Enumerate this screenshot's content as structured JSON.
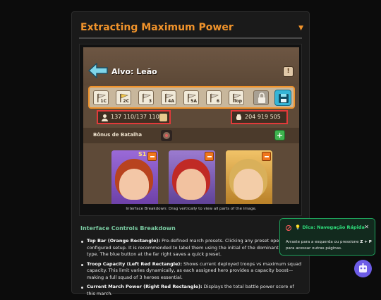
{
  "section": {
    "title": "Extracting Maximum Power",
    "toggle_icon": "chevron-down-icon"
  },
  "game": {
    "title": "Alvo: Leão",
    "presets": [
      {
        "label": "1C",
        "color": "#d7d0c4"
      },
      {
        "label": "2C",
        "color": "#f2c84b"
      },
      {
        "label": "3",
        "color": "#d7d0c4"
      },
      {
        "label": "4A",
        "color": "#d7d0c4"
      },
      {
        "label": "5A",
        "color": "#d7d0c4"
      },
      {
        "label": "6",
        "color": "#d7d0c4"
      },
      {
        "label": "Top",
        "color": "#d7d0c4"
      }
    ],
    "troop_capacity": "137 110/137 110",
    "march_power": "204 919 505",
    "bonus_label": "Bônus de Batalha",
    "heroes": [
      {
        "name": "hero-1",
        "badge": "S1",
        "bg": "#8a58c7"
      },
      {
        "name": "hero-2",
        "badge": "",
        "bg": "#8560b8"
      },
      {
        "name": "hero-3",
        "badge": "",
        "bg": "#e0aa45"
      }
    ]
  },
  "figure_caption": "Interface Breakdown: Drag vertically to view all parts of the image.",
  "controls": {
    "heading": "Interface Controls Breakdown",
    "items": [
      {
        "term": "Top Bar (Orange Rectangle):",
        "text": " Pre-defined march presets. Clicking any preset opens a pre-configured setup. It is recommended to label them using the initial of the dominant troop type. The blue button at the far right saves a quick preset."
      },
      {
        "term": "Troop Capacity (Left Red Rectangle):",
        "text": " Shows current deployed troops vs maximum squad capacity. This limit varies dynamically, as each assigned hero provides a capacity boost—making a full squad of 3 heroes essential."
      },
      {
        "term": "Current March Power (Right Red Rectangle):",
        "text": " Displays the total battle power score of this march."
      }
    ]
  },
  "toast": {
    "title": "💡 Dica: Navegação Rápida",
    "body_prefix": "Arraste para a esquerda ou pressione ",
    "key1": "Z",
    "plus": " + ",
    "key2": "P",
    "body_suffix": " para acessar outras páginas."
  }
}
